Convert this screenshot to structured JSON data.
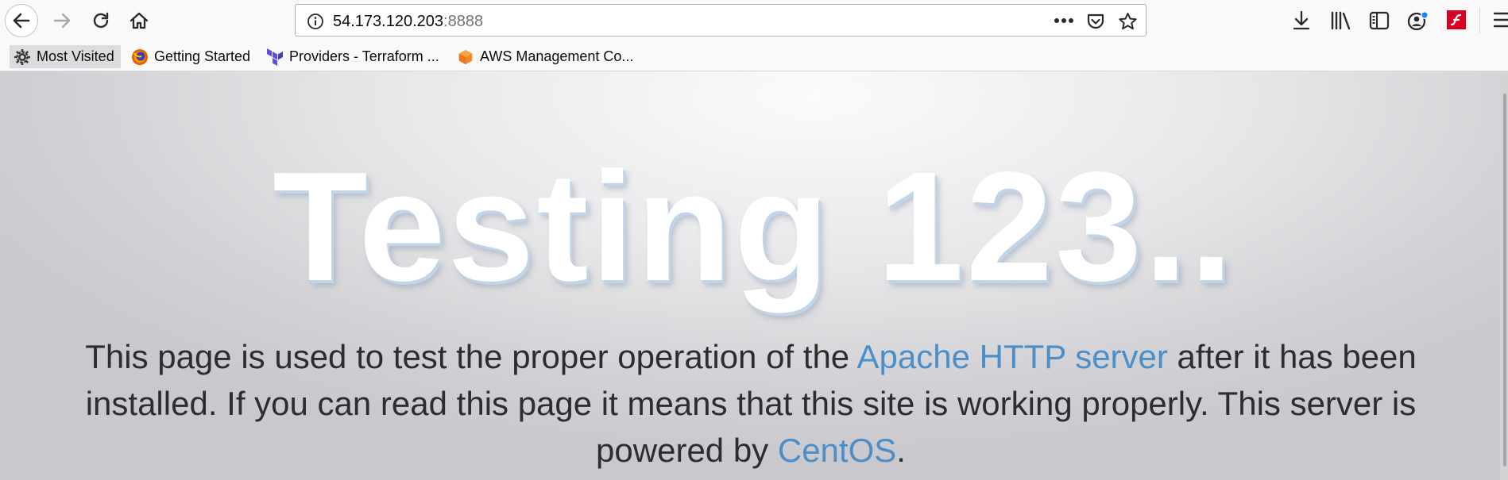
{
  "toolbar": {
    "url_host": "54.173.120.203",
    "url_port": ":8888"
  },
  "bookmarks": [
    {
      "label": "Most Visited",
      "icon": "gear-icon"
    },
    {
      "label": "Getting Started",
      "icon": "firefox-icon"
    },
    {
      "label": "Providers - Terraform ...",
      "icon": "terraform-icon"
    },
    {
      "label": "AWS Management Co...",
      "icon": "aws-cube-icon"
    }
  ],
  "page": {
    "headline": "Testing 123..",
    "intro_part1": "This page is used to test the proper operation of the ",
    "apache_link": "Apache HTTP server",
    "intro_part2": " after it has been installed. If you can read this page it means that this site is working properly. This server is powered by ",
    "centos_link": "CentOS",
    "intro_end": "."
  },
  "colors": {
    "link": "#4b8ec8",
    "flash_red": "#d70022",
    "aws_orange": "#f28c22",
    "terraform_purple": "#5c4ee5"
  }
}
